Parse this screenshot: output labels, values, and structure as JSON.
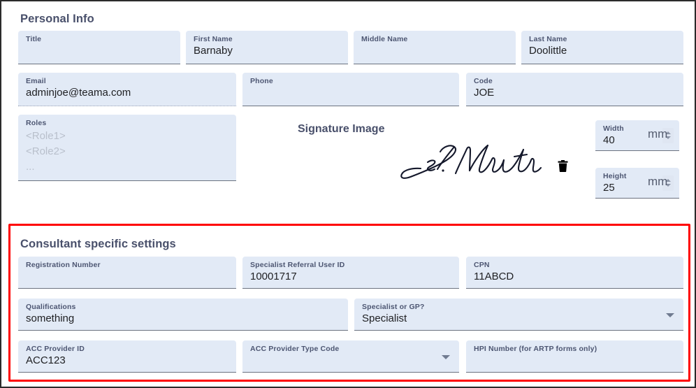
{
  "personal_info": {
    "title": "Personal Info",
    "fields": [
      {
        "label": "Title",
        "value": "",
        "type": "text"
      },
      {
        "label": "First Name",
        "value": "Barnaby",
        "type": "text"
      },
      {
        "label": "Middle Name",
        "value": "",
        "type": "text"
      },
      {
        "label": "Last Name",
        "value": "Doolittle",
        "type": "text"
      },
      {
        "label": "Email",
        "value": "adminjoe@teama.com",
        "type": "text"
      },
      {
        "label": "Phone",
        "value": "",
        "type": "text"
      },
      {
        "label": "Code",
        "value": "JOE",
        "type": "text"
      }
    ],
    "roles": {
      "label": "Roles",
      "placeholder_lines": [
        "<Role1>",
        "<Role2>",
        "..."
      ]
    }
  },
  "signature": {
    "title": "Signature Image",
    "signature_text": "Js. Newton",
    "delete_icon": "trash-icon",
    "width": {
      "label": "Width",
      "value": "40",
      "unit": "mm"
    },
    "height": {
      "label": "Height",
      "value": "25",
      "unit": "mm"
    }
  },
  "consultant": {
    "title": "Consultant specific settings",
    "highlight_color": "#ff0000",
    "fields": [
      {
        "label": "Registration Number",
        "value": "",
        "type": "text"
      },
      {
        "label": "Specialist Referral User ID",
        "value": "10001717",
        "type": "text"
      },
      {
        "label": "CPN",
        "value": "11ABCD",
        "type": "text"
      },
      {
        "label": "Qualifications",
        "value": "something",
        "type": "text"
      },
      {
        "label": "Specialist or GP?",
        "value": "Specialist",
        "type": "select"
      },
      {
        "label": "ACC Provider ID",
        "value": "ACC123",
        "type": "text"
      },
      {
        "label": "ACC Provider Type Code",
        "value": "",
        "type": "select"
      },
      {
        "label": "HPI Number (for ARTP forms only)",
        "value": "",
        "type": "text"
      }
    ]
  },
  "colors": {
    "field_bg": "#e2eaf6",
    "label": "#4d5672",
    "value": "#202124",
    "underline": "#6b7280",
    "heading": "#49506b"
  }
}
